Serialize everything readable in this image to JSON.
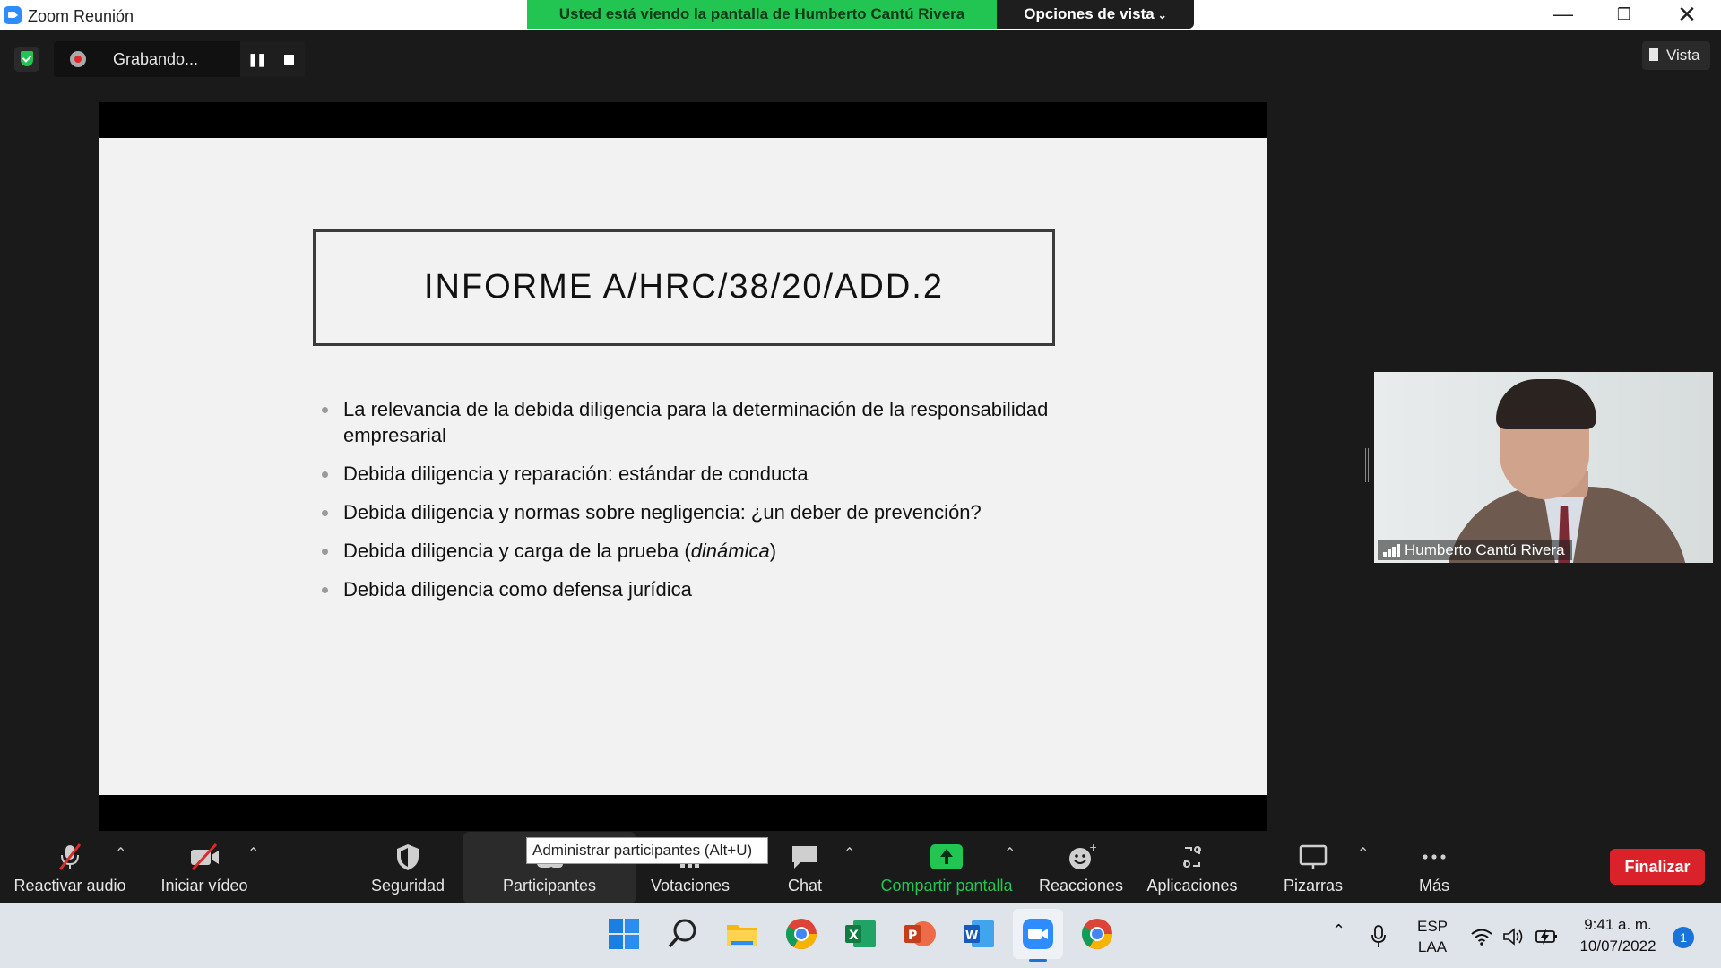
{
  "window": {
    "title": "Zoom Reunión",
    "viewing_banner": "Usted está viendo la pantalla de Humberto Cantú Rivera",
    "view_options": "Opciones de vista"
  },
  "recording": {
    "label": "Grabando..."
  },
  "view_button": "Vista",
  "slide": {
    "title": "INFORME A/HRC/38/20/ADD.2",
    "bullets": [
      "La relevancia de la debida diligencia para la determinación de la responsabilidad empresarial",
      "Debida diligencia y reparación: estándar de conducta",
      "Debida diligencia y normas sobre negligencia: ¿un deber de prevención?",
      "Debida diligencia y carga de la prueba (",
      "Debida diligencia como defensa jurídica"
    ],
    "bullet4_italic": "dinámica",
    "bullet4_end": ")"
  },
  "participant": {
    "name": "Humberto Cantú Rivera"
  },
  "toolbar": {
    "unmute": "Reactivar audio",
    "start_video": "Iniciar vídeo",
    "security": "Seguridad",
    "participants": "Participantes",
    "polls": "Votaciones",
    "chat": "Chat",
    "share": "Compartir pantalla",
    "reactions": "Reacciones",
    "apps": "Aplicaciones",
    "whiteboards": "Pizarras",
    "more": "Más",
    "end": "Finalizar",
    "tooltip": "Administrar participantes (Alt+U)"
  },
  "taskbar": {
    "lang": "ESP",
    "layout": "LAA",
    "time": "9:41 a. m.",
    "date": "10/07/2022",
    "notifications": "1"
  },
  "colors": {
    "banner_green": "#23c552",
    "end_red": "#d9222a",
    "toolbar_bg": "#1a1a1a",
    "taskbar_bg": "#dfe3ea"
  }
}
